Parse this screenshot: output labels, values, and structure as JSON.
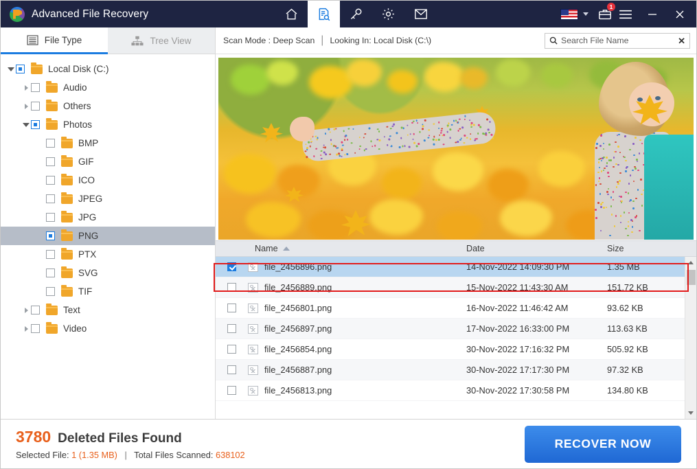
{
  "titlebar": {
    "app_title": "Advanced File Recovery",
    "logo_icon": "recovery-logo-icon",
    "nav_icons": [
      {
        "name": "home-icon",
        "label": "Home",
        "active": false
      },
      {
        "name": "scan-document-icon",
        "label": "Scan",
        "active": true
      },
      {
        "name": "key-icon",
        "label": "Register",
        "active": false
      },
      {
        "name": "gear-icon",
        "label": "Settings",
        "active": false
      },
      {
        "name": "envelope-icon",
        "label": "Support",
        "active": false
      }
    ],
    "language_flag": "us-flag-icon",
    "language_dropdown": "chevron-down-icon",
    "toolbox_icon": "toolbox-icon",
    "toolbox_badge": "1",
    "menu_icon": "hamburger-menu-icon",
    "minimize_label": "–",
    "close_label": "✕"
  },
  "left_panel": {
    "tabs": [
      {
        "label": "File Type",
        "icon": "list-icon",
        "active": true
      },
      {
        "label": "Tree View",
        "icon": "tree-hierarchy-icon",
        "active": false
      }
    ],
    "tree": [
      {
        "label": "Local Disk (C:)",
        "depth": 0,
        "arrow": "down",
        "check": "partial",
        "selected": false
      },
      {
        "label": "Audio",
        "depth": 1,
        "arrow": "right",
        "check": "empty",
        "selected": false
      },
      {
        "label": "Others",
        "depth": 1,
        "arrow": "right",
        "check": "empty",
        "selected": false
      },
      {
        "label": "Photos",
        "depth": 1,
        "arrow": "down",
        "check": "partial",
        "selected": false
      },
      {
        "label": "BMP",
        "depth": 2,
        "arrow": "none",
        "check": "empty",
        "selected": false
      },
      {
        "label": "GIF",
        "depth": 2,
        "arrow": "none",
        "check": "empty",
        "selected": false
      },
      {
        "label": "ICO",
        "depth": 2,
        "arrow": "none",
        "check": "empty",
        "selected": false
      },
      {
        "label": "JPEG",
        "depth": 2,
        "arrow": "none",
        "check": "empty",
        "selected": false
      },
      {
        "label": "JPG",
        "depth": 2,
        "arrow": "none",
        "check": "empty",
        "selected": false
      },
      {
        "label": "PNG",
        "depth": 2,
        "arrow": "none",
        "check": "partial",
        "selected": true
      },
      {
        "label": "PTX",
        "depth": 2,
        "arrow": "none",
        "check": "empty",
        "selected": false
      },
      {
        "label": "SVG",
        "depth": 2,
        "arrow": "none",
        "check": "empty",
        "selected": false
      },
      {
        "label": "TIF",
        "depth": 2,
        "arrow": "none",
        "check": "empty",
        "selected": false
      },
      {
        "label": "Text",
        "depth": 1,
        "arrow": "right",
        "check": "empty",
        "selected": false
      },
      {
        "label": "Video",
        "depth": 1,
        "arrow": "right",
        "check": "empty",
        "selected": false
      }
    ]
  },
  "scanbar": {
    "scan_mode": "Scan Mode : Deep Scan",
    "separator": "|",
    "looking_in": "Looking In: Local Disk (C:\\)",
    "search_placeholder": "Search File Name",
    "search_value": "",
    "search_icon": "search-icon",
    "clear_icon": "✕"
  },
  "preview": {
    "alt": "child-playing-in-autumn-leaves-photo"
  },
  "file_list": {
    "columns": {
      "name": "Name",
      "date": "Date",
      "size": "Size"
    },
    "sort": {
      "column": "Name",
      "direction": "asc"
    },
    "rows": [
      {
        "name": "file_2456896.png",
        "date": "14-Nov-2022 14:09:30 PM",
        "size": "1.35 MB",
        "checked": true,
        "selected": true
      },
      {
        "name": "file_2456889.png",
        "date": "15-Nov-2022 11:43:30 AM",
        "size": "151.72 KB",
        "checked": false,
        "selected": false
      },
      {
        "name": "file_2456801.png",
        "date": "16-Nov-2022 11:46:42 AM",
        "size": "93.62 KB",
        "checked": false,
        "selected": false
      },
      {
        "name": "file_2456897.png",
        "date": "17-Nov-2022 16:33:00 PM",
        "size": "113.63 KB",
        "checked": false,
        "selected": false
      },
      {
        "name": "file_2456854.png",
        "date": "30-Nov-2022 17:16:32 PM",
        "size": "505.92 KB",
        "checked": false,
        "selected": false
      },
      {
        "name": "file_2456887.png",
        "date": "30-Nov-2022 17:17:30 PM",
        "size": "97.32 KB",
        "checked": false,
        "selected": false
      },
      {
        "name": "file_2456813.png",
        "date": "30-Nov-2022 17:30:58 PM",
        "size": "134.80 KB",
        "checked": false,
        "selected": false
      }
    ]
  },
  "footer": {
    "found_count": "3780",
    "found_label": "Deleted Files Found",
    "selected_prefix": "Selected File:",
    "selected_value": "1 (1.35 MB)",
    "divider": "|",
    "scanned_prefix": "Total Files Scanned:",
    "scanned_value": "638102",
    "recover_button": "RECOVER NOW"
  },
  "colors": {
    "titlebar_bg": "#1e2442",
    "accent_blue": "#1b7ce0",
    "accent_orange": "#e8601c",
    "selected_row": "#b8d6f0",
    "annotation_red": "#e21b1b"
  }
}
